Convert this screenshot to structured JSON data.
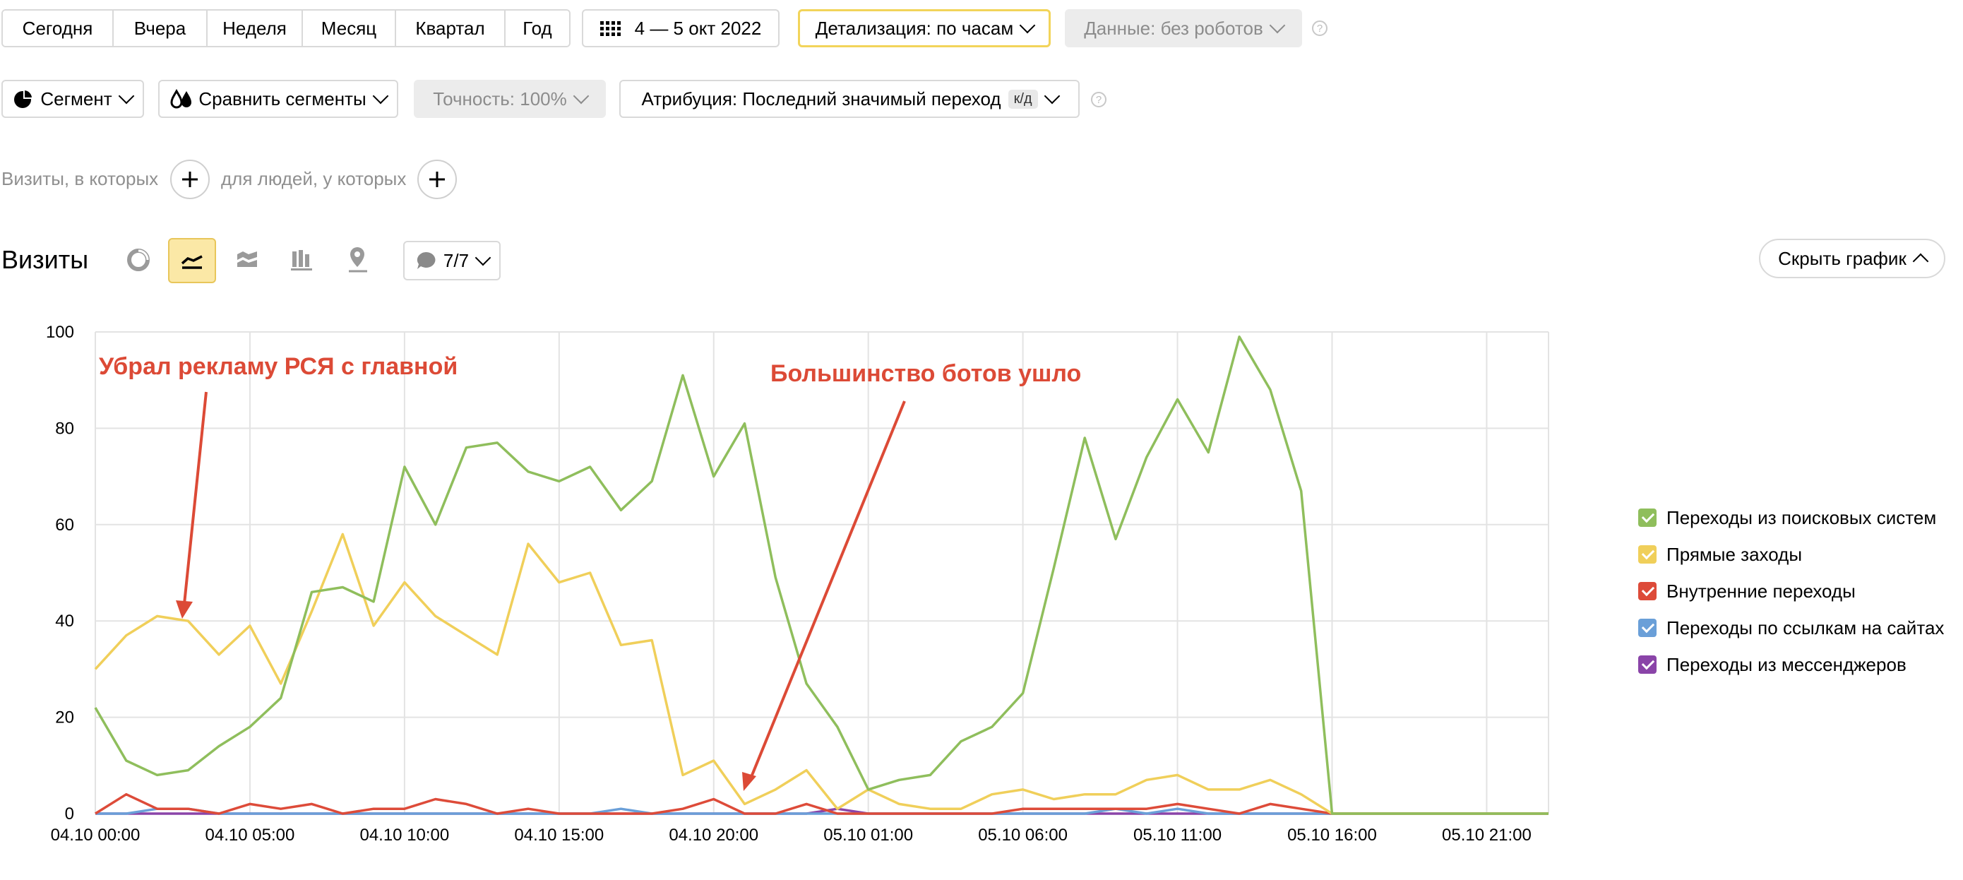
{
  "period_tabs": [
    "Сегодня",
    "Вчера",
    "Неделя",
    "Месяц",
    "Квартал",
    "Год"
  ],
  "date_range": "4 — 5 окт 2022",
  "detail": "Детализация: по часам",
  "data_filter": "Данные: без роботов",
  "segment": "Сегмент",
  "compare": "Сравнить сегменты",
  "accuracy": "Точность: 100%",
  "attribution": "Атрибуция: Последний значимый переход",
  "attribution_badge": "к/д",
  "filter": {
    "visits_label": "Визиты, в которых",
    "people_label": "для людей, у которых"
  },
  "report": {
    "title": "Визиты",
    "metrics_count": "7/7",
    "hide_chart": "Скрыть график"
  },
  "annotations": {
    "left": "Убрал рекламу РСЯ с главной",
    "right": "Большинство ботов ушло"
  },
  "colors": {
    "search": "#8fbe5c",
    "direct": "#f0cf5a",
    "internal": "#dd4b39",
    "links": "#6a9fd8",
    "messengers": "#8a44a8",
    "accent_yellow": "#fbe8a6",
    "annotation": "#dc4a36"
  },
  "chart_data": {
    "type": "line",
    "ylim": [
      0,
      100
    ],
    "y_ticks": [
      "0",
      "20",
      "40",
      "60",
      "80",
      "100"
    ],
    "x_tick_labels": [
      "04.10 00:00",
      "04.10 05:00",
      "04.10 10:00",
      "04.10 15:00",
      "04.10 20:00",
      "05.10 01:00",
      "05.10 06:00",
      "05.10 11:00",
      "05.10 16:00",
      "05.10 21:00"
    ],
    "x": [
      "04.10 00:00",
      "04.10 01:00",
      "04.10 02:00",
      "04.10 03:00",
      "04.10 04:00",
      "04.10 05:00",
      "04.10 06:00",
      "04.10 07:00",
      "04.10 08:00",
      "04.10 09:00",
      "04.10 10:00",
      "04.10 11:00",
      "04.10 12:00",
      "04.10 13:00",
      "04.10 14:00",
      "04.10 15:00",
      "04.10 16:00",
      "04.10 17:00",
      "04.10 18:00",
      "04.10 19:00",
      "04.10 20:00",
      "04.10 21:00",
      "04.10 22:00",
      "04.10 23:00",
      "05.10 00:00",
      "05.10 01:00",
      "05.10 02:00",
      "05.10 03:00",
      "05.10 04:00",
      "05.10 05:00",
      "05.10 06:00",
      "05.10 07:00",
      "05.10 08:00",
      "05.10 09:00",
      "05.10 10:00",
      "05.10 11:00",
      "05.10 12:00",
      "05.10 13:00",
      "05.10 14:00",
      "05.10 15:00",
      "05.10 16:00",
      "05.10 17:00",
      "05.10 18:00",
      "05.10 19:00",
      "05.10 20:00",
      "05.10 21:00",
      "05.10 22:00",
      "05.10 23:00"
    ],
    "grid": true,
    "legend": "right",
    "series": [
      {
        "name": "Переходы из поисковых систем",
        "color_key": "search",
        "values": [
          22,
          11,
          8,
          9,
          14,
          18,
          24,
          46,
          47,
          44,
          72,
          60,
          76,
          77,
          71,
          69,
          72,
          63,
          69,
          91,
          70,
          81,
          49,
          27,
          18,
          5,
          7,
          8,
          15,
          18,
          25,
          51,
          78,
          57,
          74,
          86,
          75,
          99,
          88,
          67,
          0,
          0,
          0,
          0,
          0,
          0,
          0,
          0
        ]
      },
      {
        "name": "Прямые заходы",
        "color_key": "direct",
        "values": [
          30,
          37,
          41,
          40,
          33,
          39,
          27,
          42,
          58,
          39,
          48,
          41,
          37,
          33,
          56,
          48,
          50,
          35,
          36,
          8,
          11,
          2,
          5,
          9,
          1,
          5,
          2,
          1,
          1,
          4,
          5,
          3,
          4,
          4,
          7,
          8,
          5,
          5,
          7,
          4,
          0,
          0,
          0,
          0,
          0,
          0,
          0,
          0
        ]
      },
      {
        "name": "Внутренние переходы",
        "color_key": "internal",
        "values": [
          0,
          4,
          1,
          1,
          0,
          2,
          1,
          2,
          0,
          1,
          1,
          3,
          2,
          0,
          1,
          0,
          0,
          0,
          0,
          1,
          3,
          0,
          0,
          2,
          0,
          0,
          0,
          0,
          0,
          0,
          1,
          1,
          1,
          1,
          1,
          2,
          1,
          0,
          2,
          1,
          0,
          0,
          0,
          0,
          0,
          0,
          0,
          0
        ]
      },
      {
        "name": "Переходы по ссылкам на сайтах",
        "color_key": "links",
        "values": [
          0,
          0,
          1,
          1,
          0,
          0,
          0,
          0,
          0,
          0,
          0,
          0,
          0,
          0,
          0,
          0,
          0,
          1,
          0,
          0,
          0,
          0,
          0,
          0,
          0,
          0,
          0,
          0,
          0,
          0,
          0,
          0,
          0,
          1,
          0,
          1,
          0,
          0,
          0,
          0,
          0,
          0,
          0,
          0,
          0,
          0,
          0,
          0
        ]
      },
      {
        "name": "Переходы из мессенджеров",
        "color_key": "messengers",
        "values": [
          0,
          0,
          0,
          0,
          0,
          0,
          0,
          0,
          0,
          0,
          0,
          0,
          0,
          0,
          0,
          0,
          0,
          0,
          0,
          0,
          0,
          0,
          0,
          0,
          1,
          0,
          0,
          0,
          0,
          0,
          0,
          0,
          0,
          0,
          0,
          0,
          0,
          0,
          0,
          0,
          0,
          0,
          0,
          0,
          0,
          0,
          0,
          0
        ]
      }
    ]
  }
}
